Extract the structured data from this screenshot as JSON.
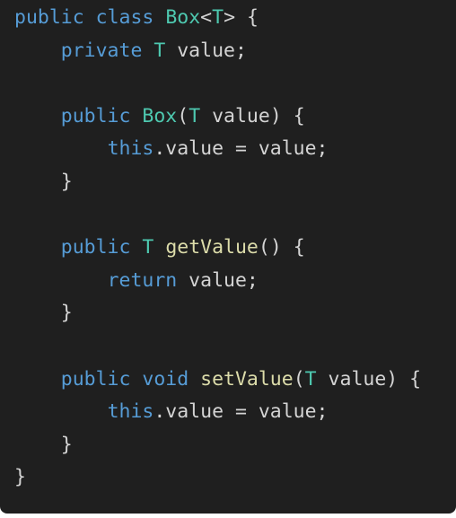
{
  "colors": {
    "background": "#1f1f1f",
    "keyword": "#569cd6",
    "type": "#4ec9b0",
    "function": "#dcdcaa",
    "text": "#d4d4d4"
  },
  "code": {
    "lines": [
      [
        {
          "t": "kw",
          "v": "public"
        },
        {
          "t": "plain",
          "v": " "
        },
        {
          "t": "kw",
          "v": "class"
        },
        {
          "t": "plain",
          "v": " "
        },
        {
          "t": "type",
          "v": "Box"
        },
        {
          "t": "plain",
          "v": "<"
        },
        {
          "t": "type",
          "v": "T"
        },
        {
          "t": "plain",
          "v": "> {"
        }
      ],
      [
        {
          "t": "plain",
          "v": "    "
        },
        {
          "t": "kw",
          "v": "private"
        },
        {
          "t": "plain",
          "v": " "
        },
        {
          "t": "type",
          "v": "T"
        },
        {
          "t": "plain",
          "v": " value;"
        }
      ],
      [],
      [
        {
          "t": "plain",
          "v": "    "
        },
        {
          "t": "kw",
          "v": "public"
        },
        {
          "t": "plain",
          "v": " "
        },
        {
          "t": "type",
          "v": "Box"
        },
        {
          "t": "plain",
          "v": "("
        },
        {
          "t": "type",
          "v": "T"
        },
        {
          "t": "plain",
          "v": " value) {"
        }
      ],
      [
        {
          "t": "plain",
          "v": "        "
        },
        {
          "t": "kw",
          "v": "this"
        },
        {
          "t": "plain",
          "v": ".value = value;"
        }
      ],
      [
        {
          "t": "plain",
          "v": "    }"
        }
      ],
      [],
      [
        {
          "t": "plain",
          "v": "    "
        },
        {
          "t": "kw",
          "v": "public"
        },
        {
          "t": "plain",
          "v": " "
        },
        {
          "t": "type",
          "v": "T"
        },
        {
          "t": "plain",
          "v": " "
        },
        {
          "t": "fn",
          "v": "getValue"
        },
        {
          "t": "plain",
          "v": "() {"
        }
      ],
      [
        {
          "t": "plain",
          "v": "        "
        },
        {
          "t": "kw",
          "v": "return"
        },
        {
          "t": "plain",
          "v": " value;"
        }
      ],
      [
        {
          "t": "plain",
          "v": "    }"
        }
      ],
      [],
      [
        {
          "t": "plain",
          "v": "    "
        },
        {
          "t": "kw",
          "v": "public"
        },
        {
          "t": "plain",
          "v": " "
        },
        {
          "t": "kw",
          "v": "void"
        },
        {
          "t": "plain",
          "v": " "
        },
        {
          "t": "fn",
          "v": "setValue"
        },
        {
          "t": "plain",
          "v": "("
        },
        {
          "t": "type",
          "v": "T"
        },
        {
          "t": "plain",
          "v": " value) {"
        }
      ],
      [
        {
          "t": "plain",
          "v": "        "
        },
        {
          "t": "kw",
          "v": "this"
        },
        {
          "t": "plain",
          "v": ".value = value;"
        }
      ],
      [
        {
          "t": "plain",
          "v": "    }"
        }
      ],
      [
        {
          "t": "plain",
          "v": "}"
        }
      ]
    ]
  }
}
